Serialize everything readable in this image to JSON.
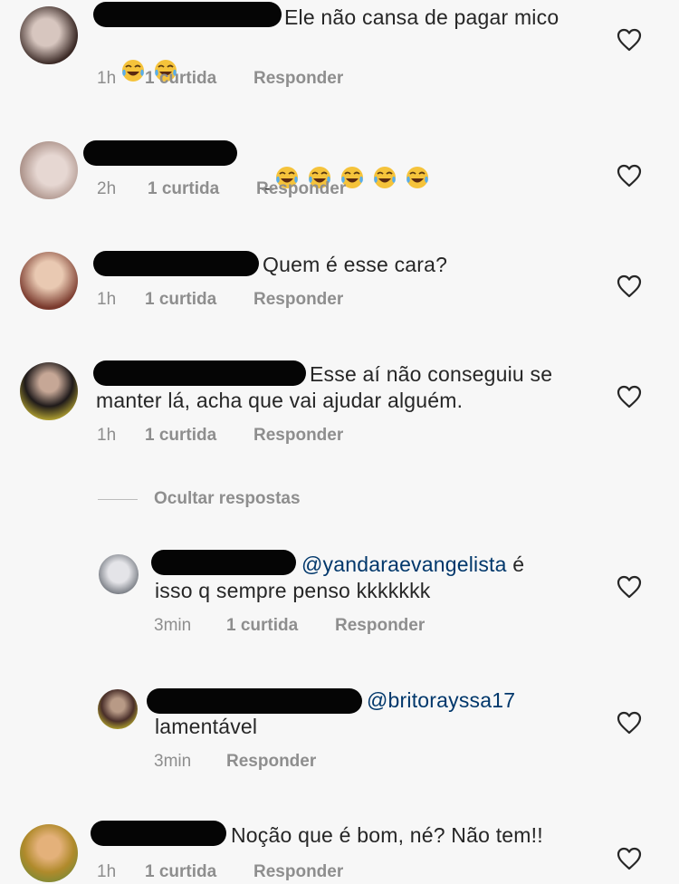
{
  "comments": [
    {
      "id": 1,
      "text_lines": [
        "Ele não cansa de pagar mico"
      ],
      "emoji_count_after": 2,
      "time": "1h",
      "likes": "1 curtida",
      "reply": "Responder",
      "avatar_colors": [
        "#3b2a26",
        "#d7c6bf"
      ]
    },
    {
      "id": 2,
      "text_lines": [],
      "emoji_count_inline": 5,
      "time": "2h",
      "likes": "1 curtida",
      "reply": "Responder",
      "avatar_colors": [
        "#a98f86",
        "#e6d7d2"
      ]
    },
    {
      "id": 3,
      "text_lines": [
        "Quem é esse cara?"
      ],
      "time": "1h",
      "likes": "1 curtida",
      "reply": "Responder",
      "avatar_colors": [
        "#7a3a2d",
        "#e9c9b2"
      ]
    },
    {
      "id": 4,
      "text_lines": [
        "Esse aí não conseguiu se",
        "manter lá, acha que vai ajudar alguém."
      ],
      "time": "1h",
      "likes": "1 curtida",
      "reply": "Responder",
      "avatar_colors": [
        "#1f1a1a",
        "#e6d23a"
      ]
    },
    {
      "id": 5,
      "reply_to": "@yandaraevangelista",
      "text_after_mention": " é",
      "text_line2": "isso q sempre penso kkkkkkk",
      "time": "3min",
      "likes": "1 curtida",
      "reply": "Responder",
      "avatar_colors": [
        "#676c74",
        "#e4e4e8"
      ]
    },
    {
      "id": 6,
      "reply_to": "@britorayssa17",
      "text_line2": "lamentável",
      "time": "3min",
      "reply": "Responder",
      "avatar_colors": [
        "#4a2f2a",
        "#d8d12e"
      ]
    },
    {
      "id": 7,
      "text_lines": [
        "Noção que é bom, né? Não tem!!"
      ],
      "time": "1h",
      "likes": "1 curtida",
      "reply": "Responder",
      "avatar_colors": [
        "#b08a2b",
        "#6c8a3a"
      ]
    }
  ],
  "hide_replies": "Ocultar respostas",
  "icons": {
    "like": "heart-outline-icon",
    "emoji": "face-with-tears-of-joy-icon"
  },
  "colors": {
    "text": "#262626",
    "meta": "#8e8e8e",
    "mention": "#00376b",
    "background": "#f7f7f7",
    "redaction": "#050505"
  }
}
